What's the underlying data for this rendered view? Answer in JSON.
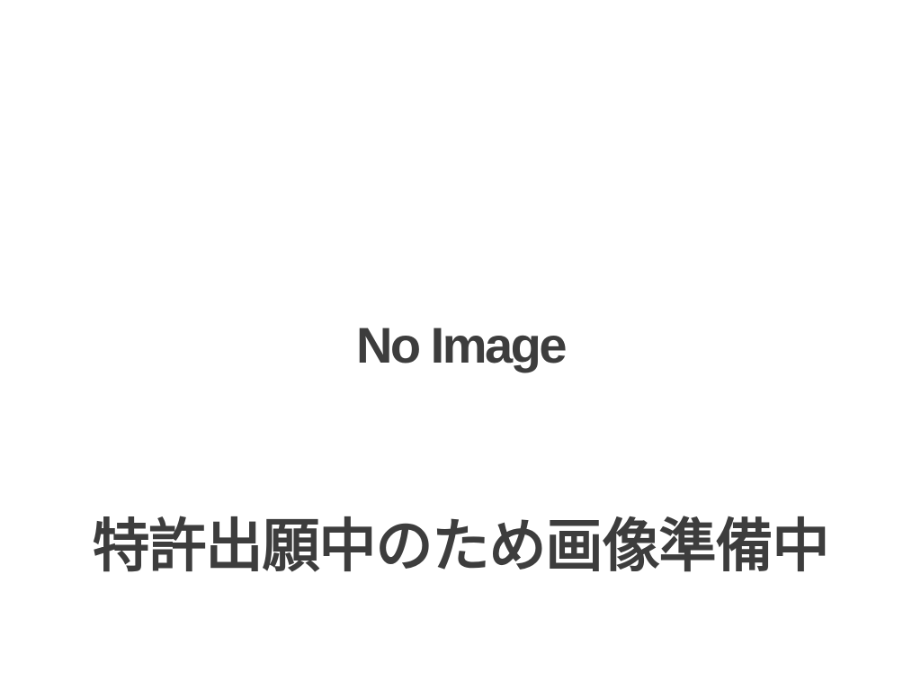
{
  "placeholder": {
    "headline": "No Image",
    "notice": "特許出願中のため画像準備中"
  },
  "colors": {
    "background": "#ffffff",
    "text": "#3d3d3d"
  }
}
